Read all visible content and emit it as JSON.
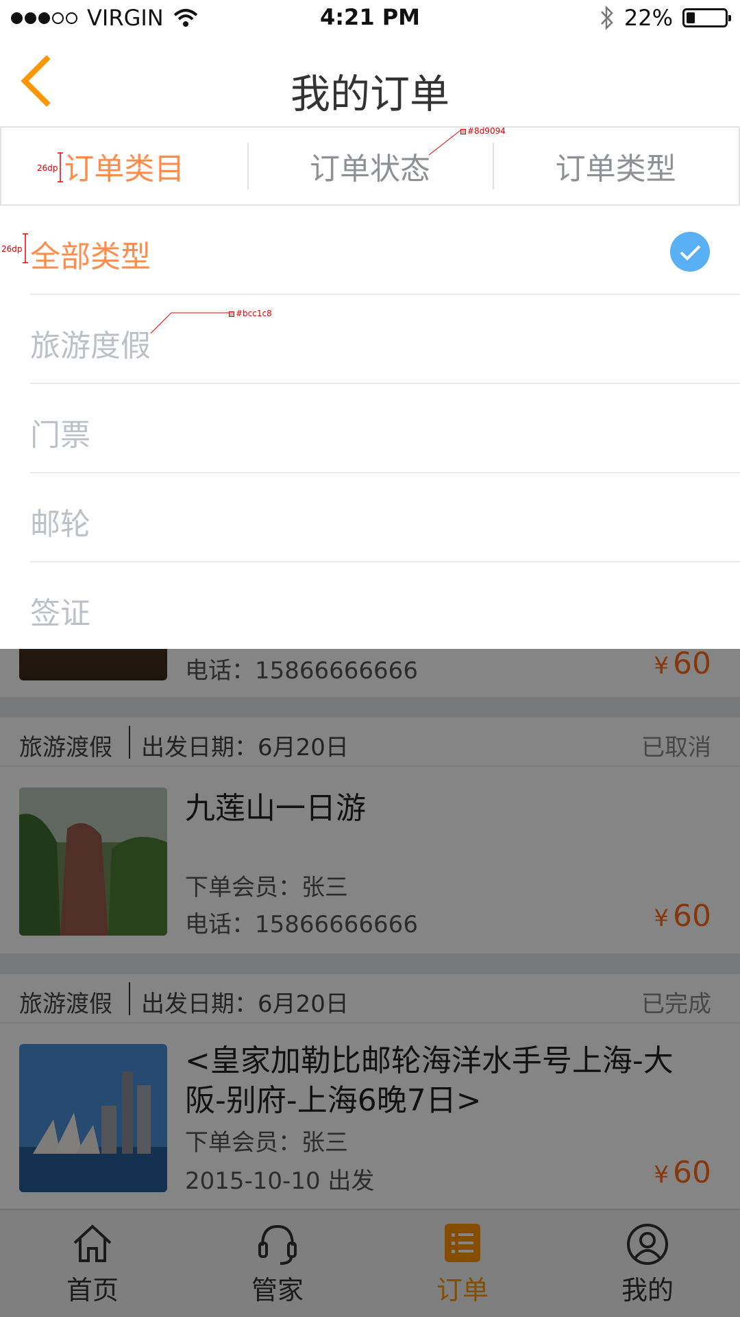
{
  "status_bar": {
    "carrier": "VIRGIN",
    "time": "4:21 PM",
    "battery_percent": "22%",
    "battery_level": 0.22,
    "signal_icon": "signal-dots-icon",
    "wifi_icon": "wifi-icon",
    "bluetooth_icon": "bluetooth-icon"
  },
  "header": {
    "title": "我的订单",
    "back_icon": "chevron-left-icon"
  },
  "filter_tabs": [
    {
      "label": "订单类目",
      "active": true
    },
    {
      "label": "订单状态",
      "active": false
    },
    {
      "label": "订单类型",
      "active": false
    }
  ],
  "dropdown": {
    "options": [
      {
        "label": "全部类型",
        "selected": true
      },
      {
        "label": "旅游度假",
        "selected": false
      },
      {
        "label": "门票",
        "selected": false
      },
      {
        "label": "邮轮",
        "selected": false
      },
      {
        "label": "签证",
        "selected": false
      }
    ],
    "check_icon": "check-circle-icon"
  },
  "annotations": {
    "tab_height": "26dp",
    "option_height": "26dp",
    "tab_color": "#8d9094",
    "option_color": "#bcc1c8"
  },
  "orders": [
    {
      "phone": "电话：15866666666",
      "currency": "¥",
      "price": "60"
    },
    {
      "category": "旅游渡假",
      "date": "出发日期：6月20日",
      "status": "已取消",
      "title": "九莲山一日游",
      "member": "下单会员：张三",
      "phone": "电话：15866666666",
      "currency": "¥",
      "price": "60"
    },
    {
      "category": "旅游渡假",
      "date": "出发日期：6月20日",
      "status": "已完成",
      "title": "<皇家加勒比邮轮海洋水手号上海-大阪-别府-上海6晚7日>",
      "member": "下单会员：张三",
      "departure": "2015-10-10 出发",
      "currency": "¥",
      "price": "60"
    }
  ],
  "bottom_tabs": [
    {
      "label": "首页",
      "icon": "home-icon",
      "active": false
    },
    {
      "label": "管家",
      "icon": "headset-icon",
      "active": false
    },
    {
      "label": "订单",
      "icon": "order-list-icon",
      "active": true
    },
    {
      "label": "我的",
      "icon": "user-icon",
      "active": false
    }
  ],
  "colors": {
    "accent": "#ff8c4a",
    "nav_accent": "#ff9500",
    "price": "#ff6a1a",
    "check": "#5ab0f4",
    "tab_text": "#8d9094",
    "option_text": "#bcc1c8"
  }
}
